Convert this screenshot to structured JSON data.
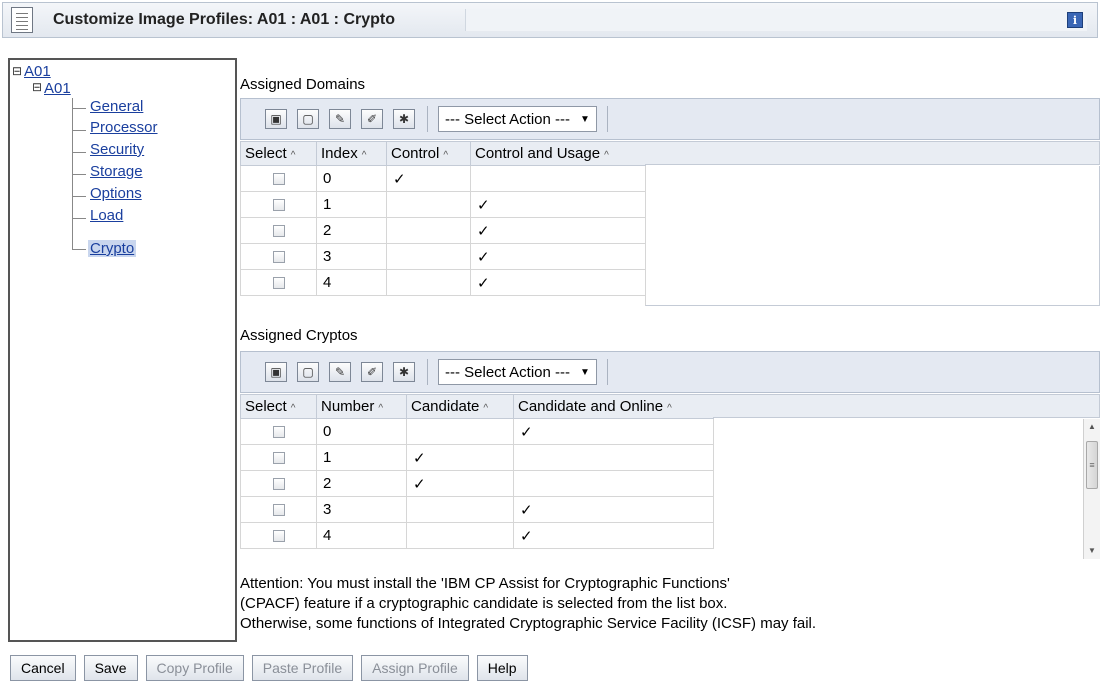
{
  "window": {
    "title": "Customize Image Profiles: A01 : A01 : Crypto",
    "info_icon": "info-icon"
  },
  "tree": {
    "root": "A01",
    "child": "A01",
    "items": [
      "General",
      "Processor",
      "Security",
      "Storage",
      "Options",
      "Load",
      "Crypto"
    ],
    "selected": "Crypto"
  },
  "domains": {
    "title": "Assigned Domains",
    "select_action": "--- Select Action ---",
    "columns": [
      "Select",
      "Index",
      "Control",
      "Control and Usage"
    ],
    "rows": [
      {
        "index": "0",
        "control": "✓",
        "usage": ""
      },
      {
        "index": "1",
        "control": "",
        "usage": "✓"
      },
      {
        "index": "2",
        "control": "",
        "usage": "✓"
      },
      {
        "index": "3",
        "control": "",
        "usage": "✓"
      },
      {
        "index": "4",
        "control": "",
        "usage": "✓"
      }
    ]
  },
  "cryptos": {
    "title": "Assigned Cryptos",
    "select_action": "--- Select Action ---",
    "columns": [
      "Select",
      "Number",
      "Candidate",
      "Candidate and Online"
    ],
    "rows": [
      {
        "number": "0",
        "candidate": "",
        "online": "✓"
      },
      {
        "number": "1",
        "candidate": "✓",
        "online": ""
      },
      {
        "number": "2",
        "candidate": "✓",
        "online": ""
      },
      {
        "number": "3",
        "candidate": "",
        "online": "✓"
      },
      {
        "number": "4",
        "candidate": "",
        "online": "✓"
      }
    ]
  },
  "attention": {
    "line1": "Attention: You must install the 'IBM CP Assist for Cryptographic Functions'",
    "line2": "(CPACF) feature if a cryptographic candidate is selected from the list box.",
    "line3": "Otherwise, some functions of Integrated Cryptographic Service Facility (ICSF) may fail."
  },
  "buttons": {
    "cancel": "Cancel",
    "save": "Save",
    "copy": "Copy Profile",
    "paste": "Paste Profile",
    "assign": "Assign Profile",
    "help": "Help"
  }
}
